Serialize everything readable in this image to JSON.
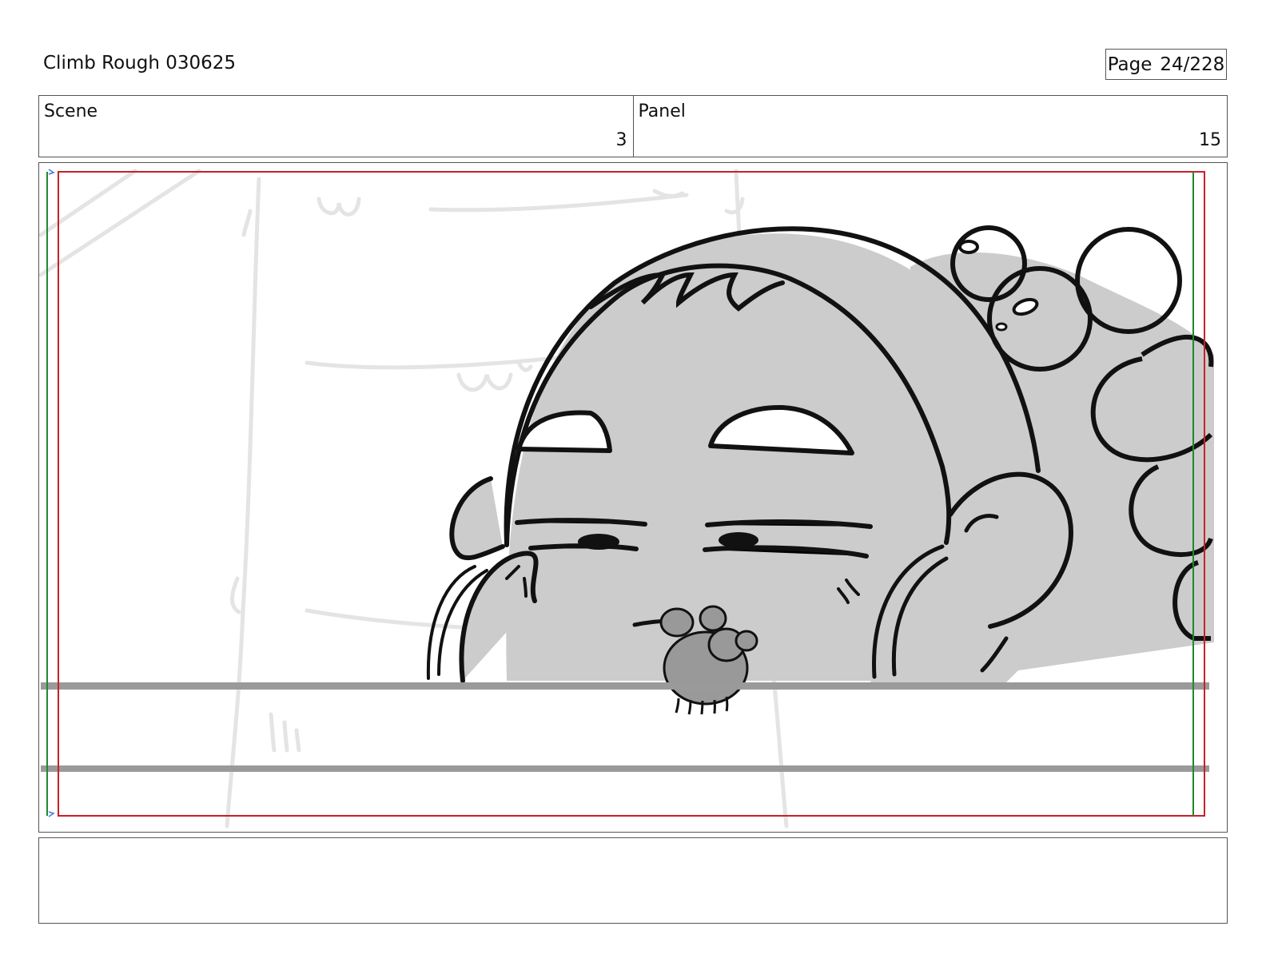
{
  "header": {
    "title": "Climb Rough 030625",
    "page_label": "Page",
    "page_value": "24/228"
  },
  "info": {
    "scene_label": "Scene",
    "scene_value": "3",
    "panel_label": "Panel",
    "panel_value": "15"
  },
  "colors": {
    "safe_red": "#c8202a",
    "safe_green": "#1f8a2b",
    "fill_gray": "#cccccc",
    "rail_gray": "#9a9a9a",
    "ink": "#111111",
    "sketch": "#e3e3e3"
  },
  "notes": {
    "text": ""
  }
}
